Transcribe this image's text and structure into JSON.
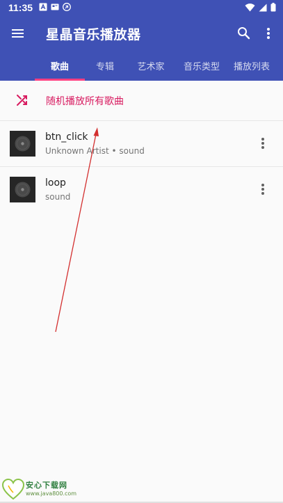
{
  "status_bar": {
    "time": "11:35"
  },
  "app_bar": {
    "title": "星晶音乐播放器",
    "icons": {
      "menu": "menu-icon",
      "search": "search-icon",
      "more": "more-vert-icon"
    }
  },
  "tabs": [
    {
      "label": "歌曲",
      "active": true
    },
    {
      "label": "专辑",
      "active": false
    },
    {
      "label": "艺术家",
      "active": false
    },
    {
      "label": "音乐类型",
      "active": false
    },
    {
      "label": "播放列表",
      "active": false
    }
  ],
  "shuffle": {
    "label": "随机播放所有歌曲",
    "icon": "shuffle-icon"
  },
  "songs": [
    {
      "title": "btn_click",
      "artist": "Unknown Artist",
      "separator": "•",
      "album": "sound"
    },
    {
      "title": "loop",
      "subtitle": "sound"
    }
  ],
  "watermark": {
    "title": "安心下载网",
    "url": "www.java800.com"
  },
  "colors": {
    "primary": "#3f51b5",
    "accent": "#d81b60",
    "tab_indicator": "#ff4081",
    "annotation_arrow": "#d32f2f"
  }
}
